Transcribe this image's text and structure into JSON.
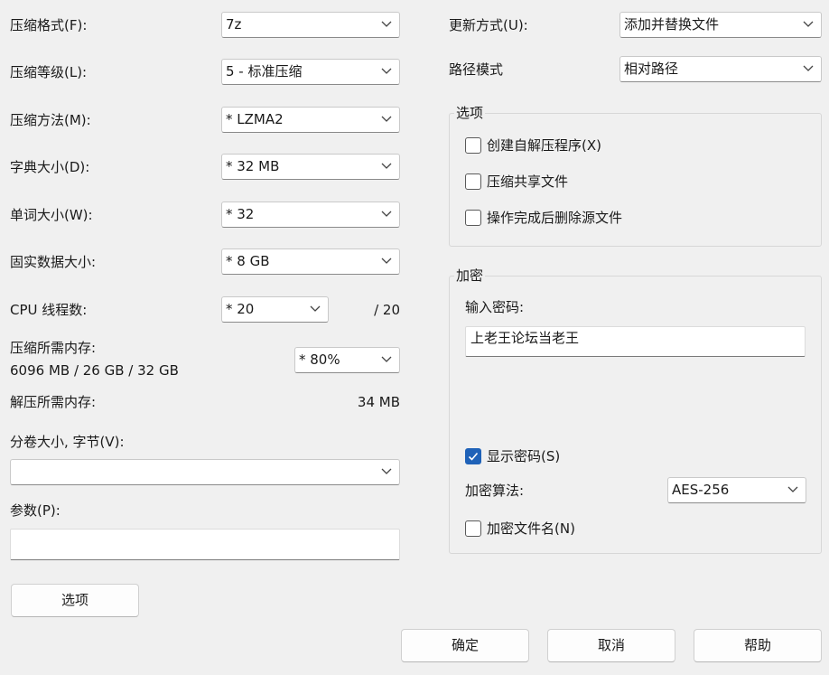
{
  "left": {
    "format_label": "压缩格式(F):",
    "format_value": "7z",
    "level_label": "压缩等级(L):",
    "level_value": "5 - 标准压缩",
    "method_label": "压缩方法(M):",
    "method_value": "*  LZMA2",
    "dict_label": "字典大小(D):",
    "dict_value": "*  32 MB",
    "word_label": "单词大小(W):",
    "word_value": "*  32",
    "solid_label": "固实数据大小:",
    "solid_value": "*  8 GB",
    "cpu_label": "CPU 线程数:",
    "cpu_value": "*  20",
    "cpu_max": "/ 20",
    "mem_compress_label": "压缩所需内存:",
    "mem_compress_detail": "6096 MB / 26 GB / 32 GB",
    "mem_percent_value": "*  80%",
    "mem_decompress_label": "解压所需内存:",
    "mem_decompress_value": "34 MB",
    "volume_label": "分卷大小, 字节(V):",
    "volume_value": "",
    "params_label": "参数(P):",
    "params_value": "",
    "options_button": "选项"
  },
  "right": {
    "update_label": "更新方式(U):",
    "update_value": "添加并替换文件",
    "path_label": "路径模式",
    "path_value": "相对路径",
    "options_group": {
      "title": "选项",
      "items": [
        {
          "label": "创建自解压程序(X)",
          "checked": false
        },
        {
          "label": "压缩共享文件",
          "checked": false
        },
        {
          "label": "操作完成后删除源文件",
          "checked": false
        }
      ]
    },
    "encrypt_group": {
      "title": "加密",
      "password_label": "输入密码:",
      "password_value": "上老王论坛当老王",
      "show_password_label": "显示密码(S)",
      "show_password_checked": true,
      "algo_label": "加密算法:",
      "algo_value": "AES-256",
      "encrypt_names_label": "加密文件名(N)",
      "encrypt_names_checked": false
    }
  },
  "buttons": {
    "ok": "确定",
    "cancel": "取消",
    "help": "帮助"
  },
  "colors": {
    "background": "#f0f0f0",
    "accent": "#1f62b8"
  }
}
